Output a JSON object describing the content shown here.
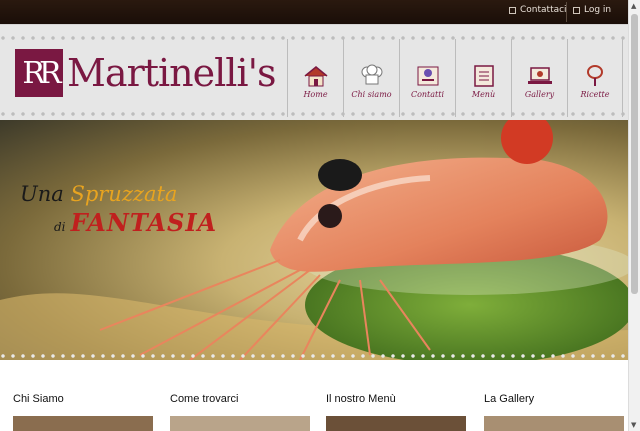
{
  "topbar": {
    "contact_label": "Contattaci",
    "login_label": "Log in"
  },
  "logo": {
    "mark": "RR",
    "name": "Martinelli's"
  },
  "nav": [
    {
      "label": "Home",
      "icon": "house-icon"
    },
    {
      "label": "Chi siamo",
      "icon": "chef-hat-icon"
    },
    {
      "label": "Contatti",
      "icon": "contact-card-icon"
    },
    {
      "label": "Menù",
      "icon": "menu-book-icon"
    },
    {
      "label": "Gallery",
      "icon": "laptop-gallery-icon"
    },
    {
      "label": "Ricette",
      "icon": "whisk-recipe-icon"
    }
  ],
  "hero": {
    "line1_word1": "Una",
    "line1_word2": "Spruzzata",
    "line2_word1": "di",
    "line2_word2": "FANTASIA"
  },
  "sections": [
    {
      "title": "Chi Siamo"
    },
    {
      "title": "Come trovarci"
    },
    {
      "title": "Il nostro Menù"
    },
    {
      "title": "La Gallery"
    }
  ],
  "colors": {
    "brand": "#7a1842",
    "topbar": "#1a0e08",
    "accent_orange": "#e8a420",
    "accent_red": "#c0201e"
  }
}
